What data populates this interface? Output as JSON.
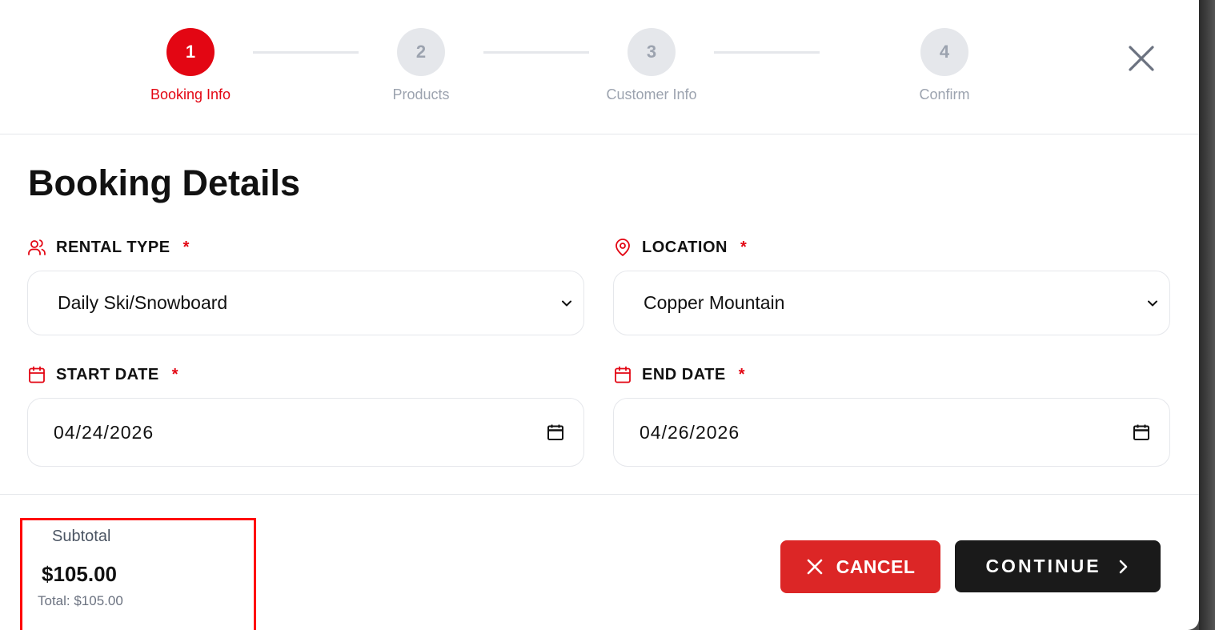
{
  "stepper": {
    "steps": [
      {
        "number": "1",
        "label": "Booking Info",
        "active": true
      },
      {
        "number": "2",
        "label": "Products",
        "active": false
      },
      {
        "number": "3",
        "label": "Customer Info",
        "active": false
      },
      {
        "number": "4",
        "label": "Confirm",
        "active": false
      }
    ],
    "close_icon": "close-icon"
  },
  "page": {
    "title": "Booking Details"
  },
  "form": {
    "rental_type": {
      "label": "RENTAL TYPE",
      "required_mark": "*",
      "value": "Daily Ski/Snowboard",
      "icon": "users-icon"
    },
    "location": {
      "label": "LOCATION",
      "required_mark": "*",
      "value": "Copper Mountain",
      "icon": "map-pin-icon"
    },
    "start_date": {
      "label": "START DATE",
      "required_mark": "*",
      "value": "04/24/2026",
      "icon": "calendar-icon"
    },
    "end_date": {
      "label": "END DATE",
      "required_mark": "*",
      "value": "04/26/2026",
      "icon": "calendar-icon"
    }
  },
  "footer": {
    "subtotal_label": "Subtotal",
    "subtotal_value": "$105.00",
    "total_line": "Total: $105.00",
    "cancel_label": "CANCEL",
    "continue_label": "CONTINUE"
  },
  "colors": {
    "accent": "#e30613",
    "cancel": "#dc2626",
    "continue": "#1a1a1a",
    "inactive_step": "#e5e7eb",
    "highlight_box": "#ff0000"
  }
}
